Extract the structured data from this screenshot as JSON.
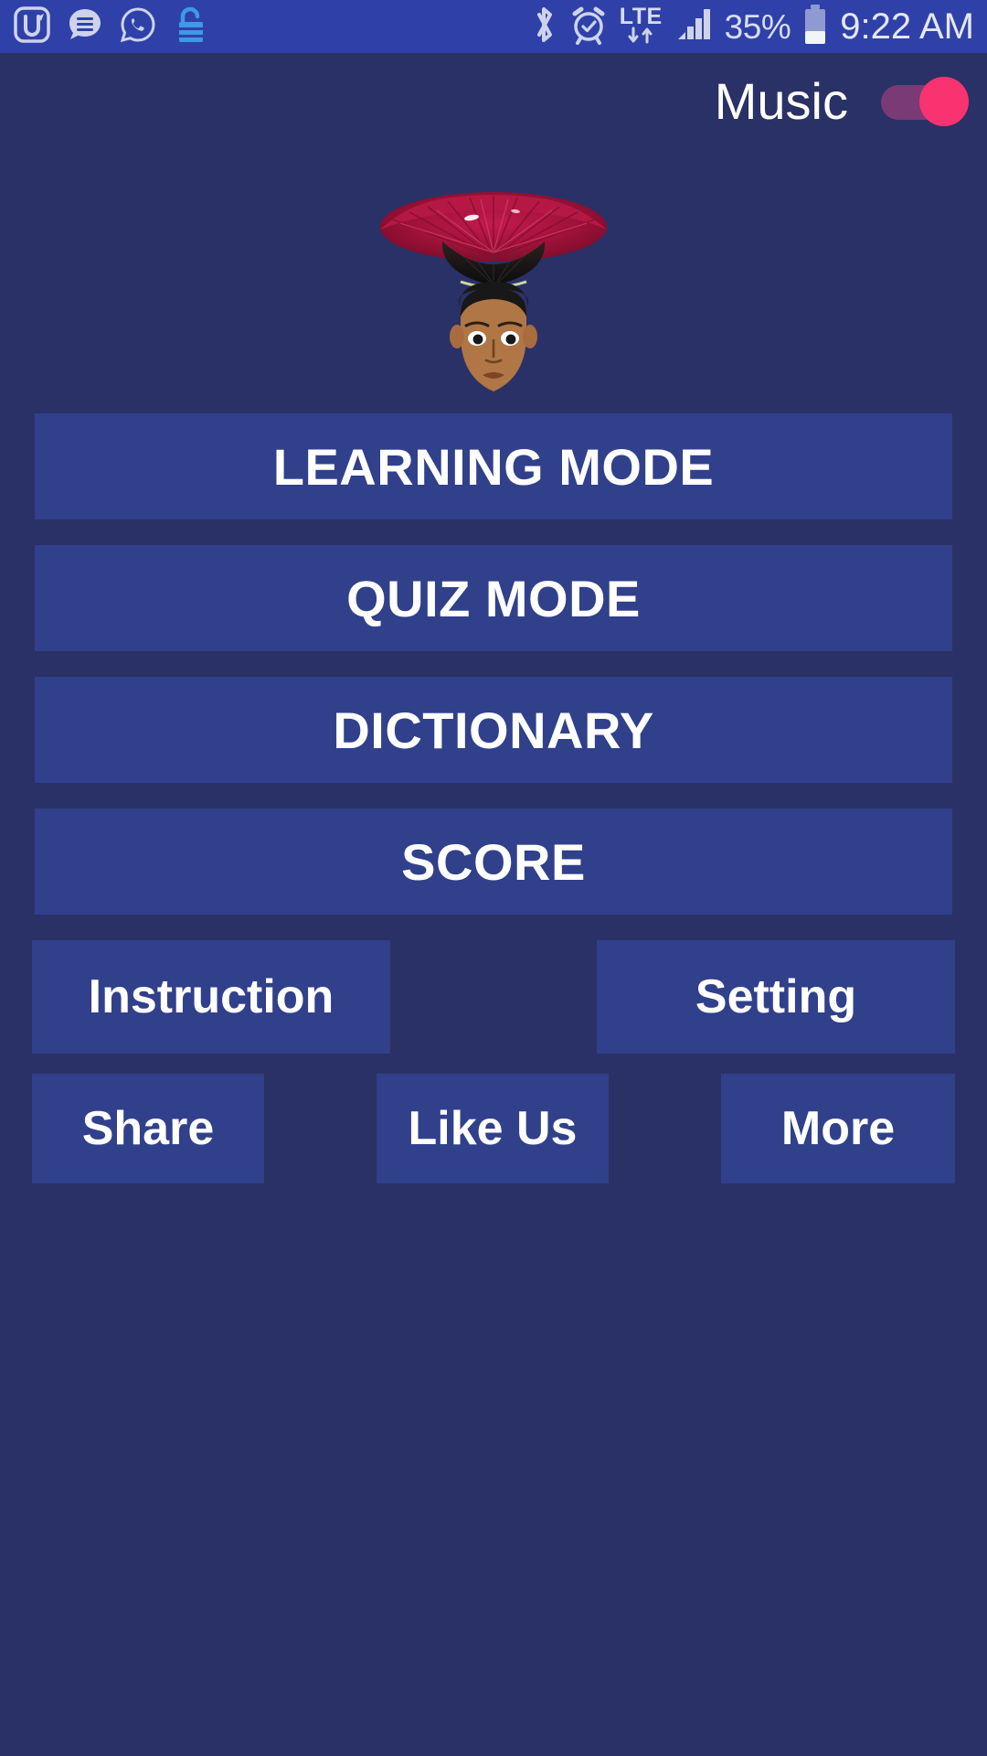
{
  "statusbar": {
    "left_icons": [
      {
        "name": "u-app-icon",
        "label": "U"
      },
      {
        "name": "message-bubble-icon",
        "label": "Messages"
      },
      {
        "name": "whatsapp-icon",
        "label": "WhatsApp"
      },
      {
        "name": "unlock-icon",
        "label": "Unlocked"
      }
    ],
    "right_icons": [
      {
        "name": "bluetooth-icon",
        "label": "Bluetooth"
      },
      {
        "name": "alarm-clock-icon",
        "label": "Alarm"
      },
      {
        "name": "lte-icon",
        "label": "LTE"
      },
      {
        "name": "signal-bars-icon",
        "label": "Signal"
      },
      {
        "name": "battery-icon",
        "label": "Battery"
      }
    ],
    "lte_text": "LTE",
    "battery_percent": "35%",
    "battery_level": 35,
    "time": "9:22 AM"
  },
  "header": {
    "music_label": "Music",
    "music_enabled": true
  },
  "mascot": {
    "name": "boy-with-red-feather-hat",
    "hat_color": "#A8123C",
    "hat_highlight": "#D6336C",
    "hat_base_color": "#141414",
    "skin_color": "#B07645",
    "hair_color": "#181818"
  },
  "menu": {
    "primary_buttons": [
      {
        "label": "LEARNING MODE",
        "name": "learning-mode-button"
      },
      {
        "label": "QUIZ MODE",
        "name": "quiz-mode-button"
      },
      {
        "label": "DICTIONARY",
        "name": "dictionary-button"
      },
      {
        "label": "SCORE",
        "name": "score-button"
      }
    ],
    "secondary_buttons": [
      {
        "label": "Instruction",
        "name": "instruction-button"
      },
      {
        "label": "Setting",
        "name": "setting-button"
      }
    ],
    "tertiary_buttons": [
      {
        "label": "Share",
        "name": "share-button"
      },
      {
        "label": "Like Us",
        "name": "like-us-button"
      },
      {
        "label": "More",
        "name": "more-button"
      }
    ]
  },
  "colors": {
    "background": "#2a3166",
    "button": "#31408a",
    "statusbar": "#2f41a8",
    "accent_pink": "#f9336f",
    "toggle_track": "#7a3a75",
    "text": "#ffffff"
  }
}
